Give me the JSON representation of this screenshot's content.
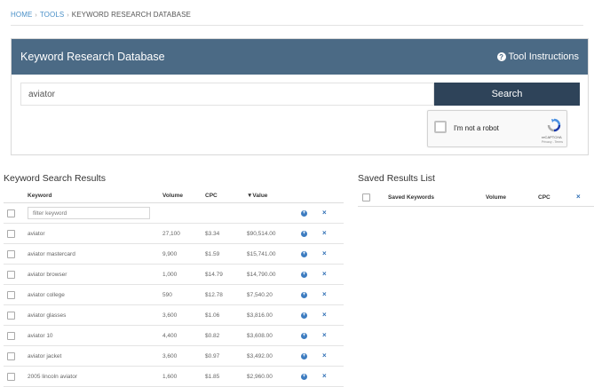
{
  "breadcrumb": {
    "home": "HOME",
    "tools": "TOOLS",
    "current": "KEYWORD RESEARCH DATABASE",
    "separator": "›"
  },
  "panel": {
    "title": "Keyword Research Database",
    "tool_instructions": "Tool Instructions"
  },
  "search": {
    "value": "aviator",
    "button_label": "Search"
  },
  "captcha": {
    "label": "I'm not a robot",
    "brand": "reCAPTCHA",
    "terms": "Privacy - Terms"
  },
  "results": {
    "title": "Keyword Search Results",
    "columns": {
      "keyword": "Keyword",
      "volume": "Volume",
      "cpc": "CPC",
      "value": "▼Value"
    },
    "filter_placeholder": "filter keyword",
    "rows": [
      {
        "keyword": "aviator",
        "volume": "27,100",
        "cpc": "$3.34",
        "value": "$90,514.00"
      },
      {
        "keyword": "aviator mastercard",
        "volume": "9,900",
        "cpc": "$1.59",
        "value": "$15,741.00"
      },
      {
        "keyword": "aviator browser",
        "volume": "1,000",
        "cpc": "$14.79",
        "value": "$14,790.00"
      },
      {
        "keyword": "aviator college",
        "volume": "590",
        "cpc": "$12.78",
        "value": "$7,540.20"
      },
      {
        "keyword": "aviator glasses",
        "volume": "3,600",
        "cpc": "$1.06",
        "value": "$3,816.00"
      },
      {
        "keyword": "aviator 10",
        "volume": "4,400",
        "cpc": "$0.82",
        "value": "$3,608.00"
      },
      {
        "keyword": "aviator jacket",
        "volume": "3,600",
        "cpc": "$0.97",
        "value": "$3,492.00"
      },
      {
        "keyword": "2005 lincoln aviator",
        "volume": "1,600",
        "cpc": "$1.85",
        "value": "$2,960.00"
      }
    ]
  },
  "saved": {
    "title": "Saved Results List",
    "columns": {
      "keywords": "Saved Keywords",
      "volume": "Volume",
      "cpc": "CPC"
    }
  },
  "icons": {
    "add": "plus-circle-icon",
    "remove": "close-icon",
    "help": "question-circle-icon"
  },
  "colors": {
    "header_bg": "#4b6a85",
    "search_button": "#2e4359",
    "link": "#4a90c8",
    "icon_blue": "#3d7cc0"
  }
}
